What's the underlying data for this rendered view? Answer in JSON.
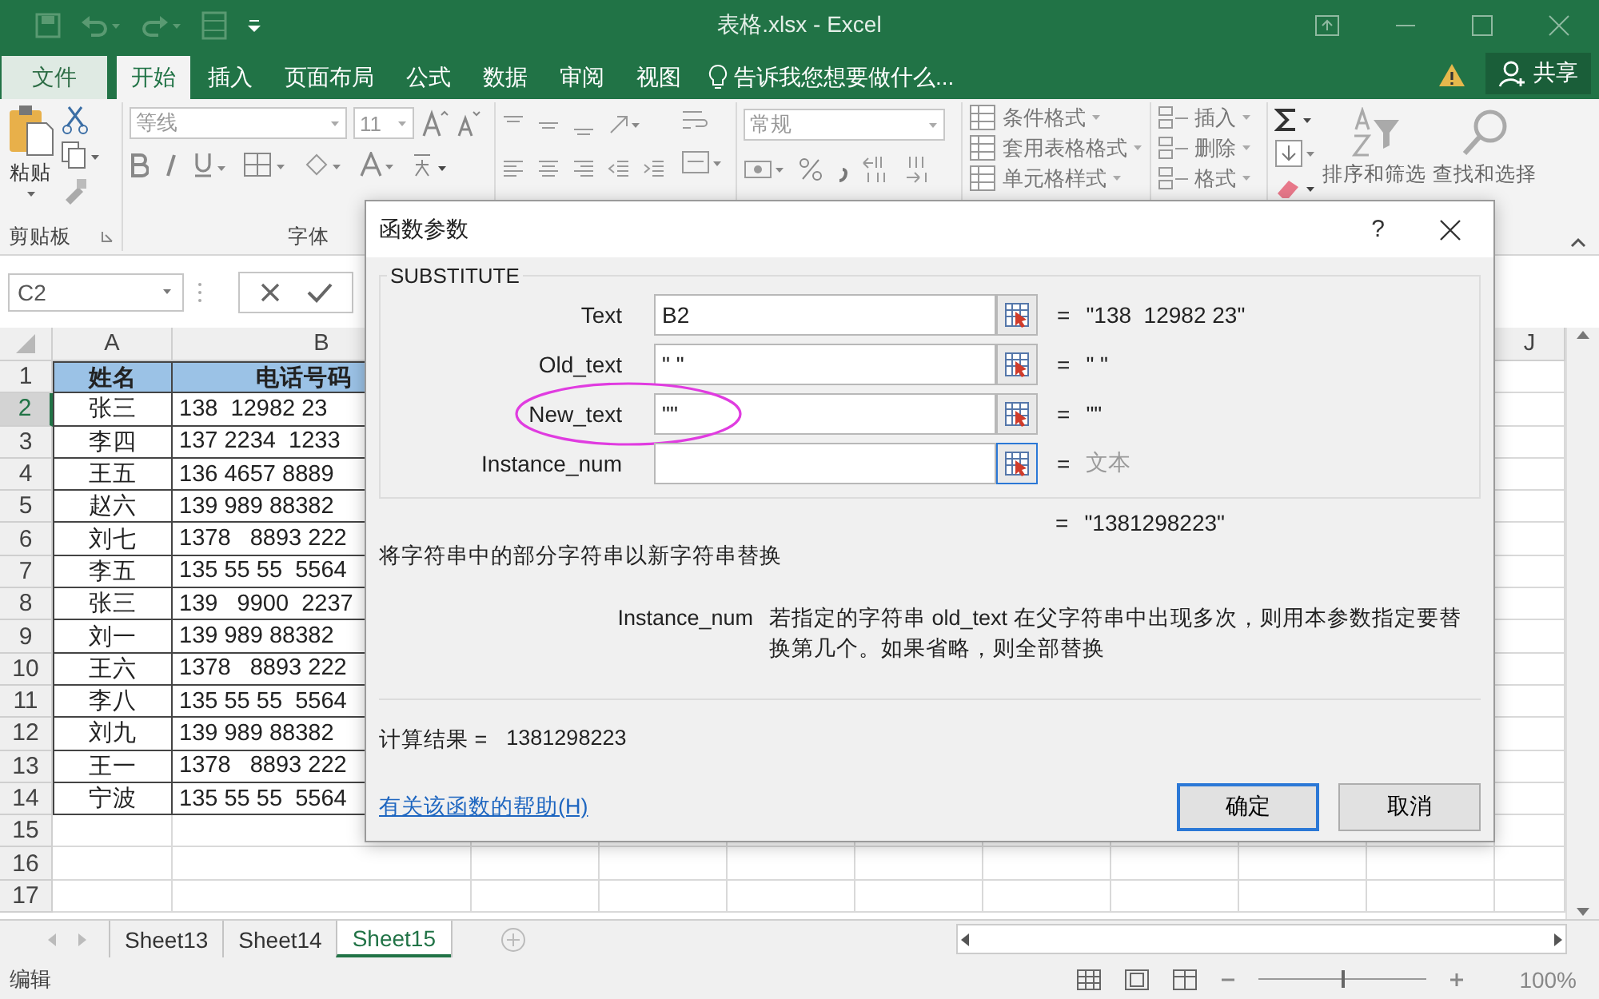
{
  "window": {
    "title": "表格.xlsx - Excel"
  },
  "ribbon_tabs": [
    {
      "label": "文件",
      "kind": "file",
      "selected": false
    },
    {
      "label": "开始",
      "kind": "tab",
      "selected": true
    },
    {
      "label": "插入",
      "kind": "tab",
      "selected": false
    },
    {
      "label": "页面布局",
      "kind": "tab",
      "selected": false
    },
    {
      "label": "公式",
      "kind": "tab",
      "selected": false
    },
    {
      "label": "数据",
      "kind": "tab",
      "selected": false
    },
    {
      "label": "审阅",
      "kind": "tab",
      "selected": false
    },
    {
      "label": "视图",
      "kind": "tab",
      "selected": false
    }
  ],
  "tell_me": {
    "placeholder": "告诉我您想要做什么..."
  },
  "share_button": "共享",
  "ribbon": {
    "paste": "粘贴",
    "clipboard_label": "剪贴板",
    "font_name": "等线",
    "font_size": "11",
    "font_label": "字体",
    "number_format": "常规",
    "styles": [
      "条件格式",
      "套用表格格式",
      "单元格样式"
    ],
    "cells": [
      "插入",
      "删除",
      "格式"
    ],
    "sort": "排序和筛选",
    "find": "查找和选择"
  },
  "name_box": "C2",
  "sheet": {
    "columns": [
      {
        "label": "A"
      },
      {
        "label": "B"
      },
      {
        "label": "J"
      }
    ],
    "rows": [
      {
        "number": "1",
        "selected": false,
        "kind": "header",
        "cells": [
          "姓名",
          "电话号码"
        ]
      },
      {
        "number": "2",
        "selected": true,
        "kind": "data",
        "cells": [
          "张三",
          "138  12982 23"
        ]
      },
      {
        "number": "3",
        "selected": false,
        "kind": "data",
        "cells": [
          "李四",
          "137 2234  1233"
        ]
      },
      {
        "number": "4",
        "selected": false,
        "kind": "data",
        "cells": [
          "王五",
          "136 4657 8889"
        ]
      },
      {
        "number": "5",
        "selected": false,
        "kind": "data",
        "cells": [
          "赵六",
          "139 989 88382"
        ]
      },
      {
        "number": "6",
        "selected": false,
        "kind": "data",
        "cells": [
          "刘七",
          "1378   8893 222"
        ]
      },
      {
        "number": "7",
        "selected": false,
        "kind": "data",
        "cells": [
          "李五",
          "135 55 55  5564"
        ]
      },
      {
        "number": "8",
        "selected": false,
        "kind": "data",
        "cells": [
          "张三",
          "139   9900  2237"
        ]
      },
      {
        "number": "9",
        "selected": false,
        "kind": "data",
        "cells": [
          "刘一",
          "139 989 88382"
        ]
      },
      {
        "number": "10",
        "selected": false,
        "kind": "data",
        "cells": [
          "王六",
          "1378   8893 222"
        ]
      },
      {
        "number": "11",
        "selected": false,
        "kind": "data",
        "cells": [
          "李八",
          "135 55 55  5564"
        ]
      },
      {
        "number": "12",
        "selected": false,
        "kind": "data",
        "cells": [
          "刘九",
          "139 989 88382"
        ]
      },
      {
        "number": "13",
        "selected": false,
        "kind": "data",
        "cells": [
          "王一",
          "1378   8893 222"
        ]
      },
      {
        "number": "14",
        "selected": false,
        "kind": "data",
        "cells": [
          "宁波",
          "135 55 55  5564"
        ]
      },
      {
        "number": "15",
        "selected": false,
        "kind": "empty"
      },
      {
        "number": "16",
        "selected": false,
        "kind": "empty"
      },
      {
        "number": "17",
        "selected": false,
        "kind": "empty"
      }
    ]
  },
  "dialog": {
    "title": "函数参数",
    "help_button": "?",
    "function": "SUBSTITUTE",
    "arguments": [
      {
        "label": "Text",
        "value": "B2",
        "equals": "=",
        "result": "\"138  12982 23\"",
        "hint": false,
        "circled": false,
        "focused": false
      },
      {
        "label": "Old_text",
        "value": "\" \"",
        "equals": "=",
        "result": "\" \"",
        "hint": false,
        "circled": false,
        "focused": false
      },
      {
        "label": "New_text",
        "value": "\"\"",
        "equals": "=",
        "result": "\"\"",
        "hint": false,
        "circled": true,
        "focused": false
      },
      {
        "label": "Instance_num",
        "equals": "=",
        "result": "文本",
        "hint": true,
        "circled": false,
        "focused": true
      }
    ],
    "formula_result": {
      "equals": "=",
      "value": "\"1381298223\""
    },
    "description": "将字符串中的部分字符串以新字符串替换",
    "argument_help": {
      "label": "Instance_num",
      "text": "若指定的字符串 old_text 在父字符串中出现多次，则用本参数指定要替换第几个。如果省略，则全部替换"
    },
    "result_label": "计算结果 =",
    "result_value": "1381298223",
    "help_link": "有关该函数的帮助(H)",
    "buttons": [
      {
        "label": "确定",
        "default": true
      },
      {
        "label": "取消",
        "default": false
      }
    ]
  },
  "sheet_tabs": [
    {
      "label": "Sheet13",
      "selected": false
    },
    {
      "label": "Sheet14",
      "selected": false
    },
    {
      "label": "Sheet15",
      "selected": true
    }
  ],
  "status_bar": {
    "mode": "编辑",
    "zoom_slider": {
      "level": 0.5
    },
    "zoom": "100%"
  }
}
